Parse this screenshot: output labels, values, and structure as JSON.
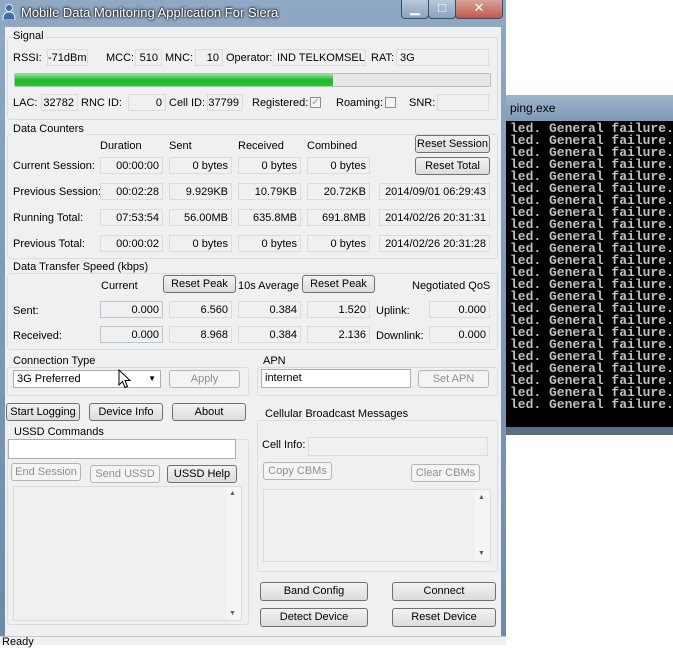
{
  "window": {
    "title": "Mobile Data Monitoring Application For Siera"
  },
  "console": {
    "title": "ping.exe",
    "lines": [
      "led. General failure.",
      "led. General failure.",
      "led. General failure.",
      "led. General failure.",
      "led. General failure.",
      "led. General failure.",
      "led. General failure.",
      "led. General failure.",
      "led. General failure.",
      "led. General failure.",
      "led. General failure.",
      "led. General failure.",
      "led. General failure.",
      "led. General failure.",
      "led. General failure.",
      "led. General failure.",
      "led. General failure.",
      "led. General failure.",
      "led. General failure.",
      "led. General failure.",
      "led. General failure.",
      "led. General failure.",
      "led. General failure.",
      "led. General failure."
    ]
  },
  "signal": {
    "group_label": "Signal",
    "rssi_label": "RSSI:",
    "rssi": "-71dBm",
    "mcc_label": "MCC:",
    "mcc": "510",
    "mnc_label": "MNC:",
    "mnc": "10",
    "operator_label": "Operator:",
    "operator": "IND TELKOMSEL",
    "rat_label": "RAT:",
    "rat": "3G",
    "strength_fraction": 0.67,
    "lac_label": "LAC:",
    "lac": "32782",
    "rnc_label": "RNC ID:",
    "rnc": "0",
    "cellid_label": "Cell ID:",
    "cellid": "37799",
    "registered_label": "Registered:",
    "registered_check": "✓",
    "roaming_label": "Roaming:",
    "snr_label": "SNR:",
    "snr": ""
  },
  "counters": {
    "group_label": "Data Counters",
    "headers": {
      "duration": "Duration",
      "sent": "Sent",
      "received": "Received",
      "combined": "Combined"
    },
    "rows": [
      {
        "label": "Current Session:",
        "duration": "00:00:00",
        "sent": "0 bytes",
        "received": "0 bytes",
        "combined": "0 bytes",
        "date": ""
      },
      {
        "label": "Previous Session:",
        "duration": "00:02:28",
        "sent": "9.929KB",
        "received": "10.79KB",
        "combined": "20.72KB",
        "date": "2014/09/01 06:29:43"
      },
      {
        "label": "Running Total:",
        "duration": "07:53:54",
        "sent": "56.00MB",
        "received": "635.8MB",
        "combined": "691.8MB",
        "date": "2014/02/26 20:31:31"
      },
      {
        "label": "Previous Total:",
        "duration": "00:00:02",
        "sent": "0 bytes",
        "received": "0 bytes",
        "combined": "0 bytes",
        "date": "2014/02/26 20:31:28"
      }
    ],
    "reset_session": "Reset Session",
    "reset_total": "Reset Total"
  },
  "speed": {
    "group_label": "Data Transfer Speed (kbps)",
    "current_label": "Current",
    "reset_peak_1": "Reset Peak",
    "avg_label": "10s Average",
    "reset_peak_2": "Reset Peak",
    "qos_label": "Negotiated QoS",
    "sent_label": "Sent:",
    "sent_current": "0.000",
    "sent_peak": "6.560",
    "sent_avg": "0.384",
    "sent_peak2": "1.520",
    "uplink_label": "Uplink:",
    "uplink": "0.000",
    "received_label": "Received:",
    "recv_current": "0.000",
    "recv_peak": "8.968",
    "recv_avg": "0.384",
    "recv_peak2": "2.136",
    "downlink_label": "Downlink:",
    "downlink": "0.000"
  },
  "connection": {
    "group_label": "Connection Type",
    "selected": "3G Preferred",
    "apply": "Apply"
  },
  "apn": {
    "group_label": "APN",
    "value": "internet",
    "set_apn": "Set APN"
  },
  "actions": {
    "start_logging": "Start Logging",
    "device_info": "Device Info",
    "about": "About"
  },
  "ussd": {
    "group_label": "USSD Commands",
    "input_value": "",
    "end_session": "End Session",
    "send_ussd": "Send USSD",
    "ussd_help": "USSD Help"
  },
  "cbm": {
    "group_label": "Cellular Broadcast Messages",
    "cell_info_label": "Cell Info:",
    "cell_info": "",
    "copy": "Copy CBMs",
    "clear": "Clear CBMs"
  },
  "bottom": {
    "band_config": "Band Config",
    "connect": "Connect",
    "detect_device": "Detect Device",
    "reset_device": "Reset Device"
  },
  "status": {
    "text": "Ready"
  }
}
